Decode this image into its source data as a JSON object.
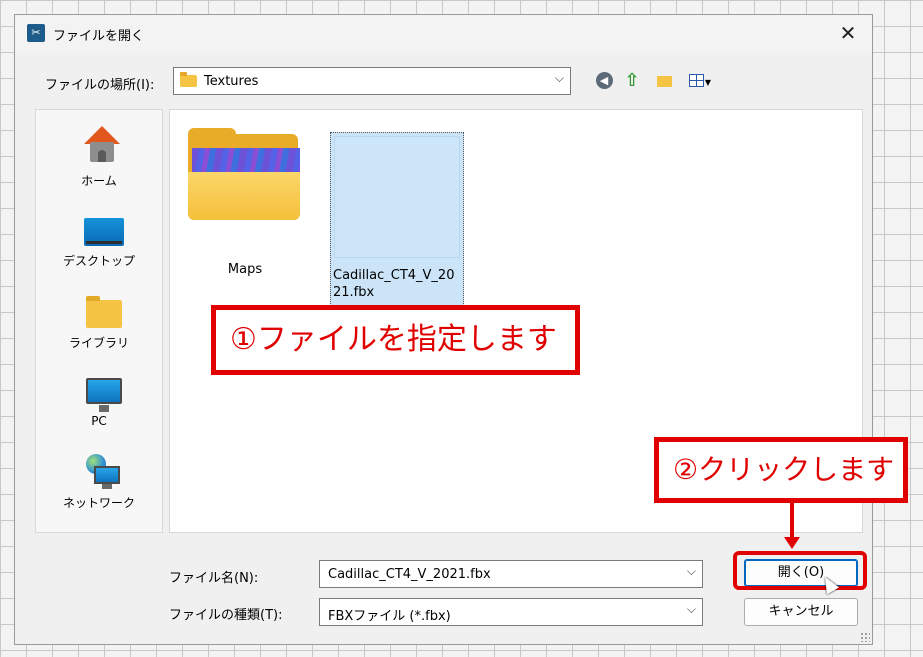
{
  "dialog": {
    "title": "ファイルを開く",
    "close_glyph": "✕"
  },
  "location": {
    "label": "ファイルの場所(I):",
    "value": "Textures"
  },
  "places": [
    {
      "label": "ホーム"
    },
    {
      "label": "デスクトップ"
    },
    {
      "label": "ライブラリ"
    },
    {
      "label": "PC"
    },
    {
      "label": "ネットワーク"
    }
  ],
  "files": [
    {
      "name": "Maps",
      "type": "folder"
    },
    {
      "name": "Cadillac_CT4_V_2021.fbx",
      "type": "file",
      "selected": true
    }
  ],
  "filename": {
    "label": "ファイル名(N):",
    "value": "Cadillac_CT4_V_2021.fbx"
  },
  "filetype": {
    "label": "ファイルの種類(T):",
    "value": "FBXファイル (*.fbx)"
  },
  "buttons": {
    "open": "開く(O)",
    "cancel": "キャンセル"
  },
  "annotations": {
    "step1": "①ファイルを指定します",
    "step2": "②クリックします"
  },
  "colors": {
    "annotation_red": "#e00000",
    "selection_blue": "#cce4f7"
  }
}
